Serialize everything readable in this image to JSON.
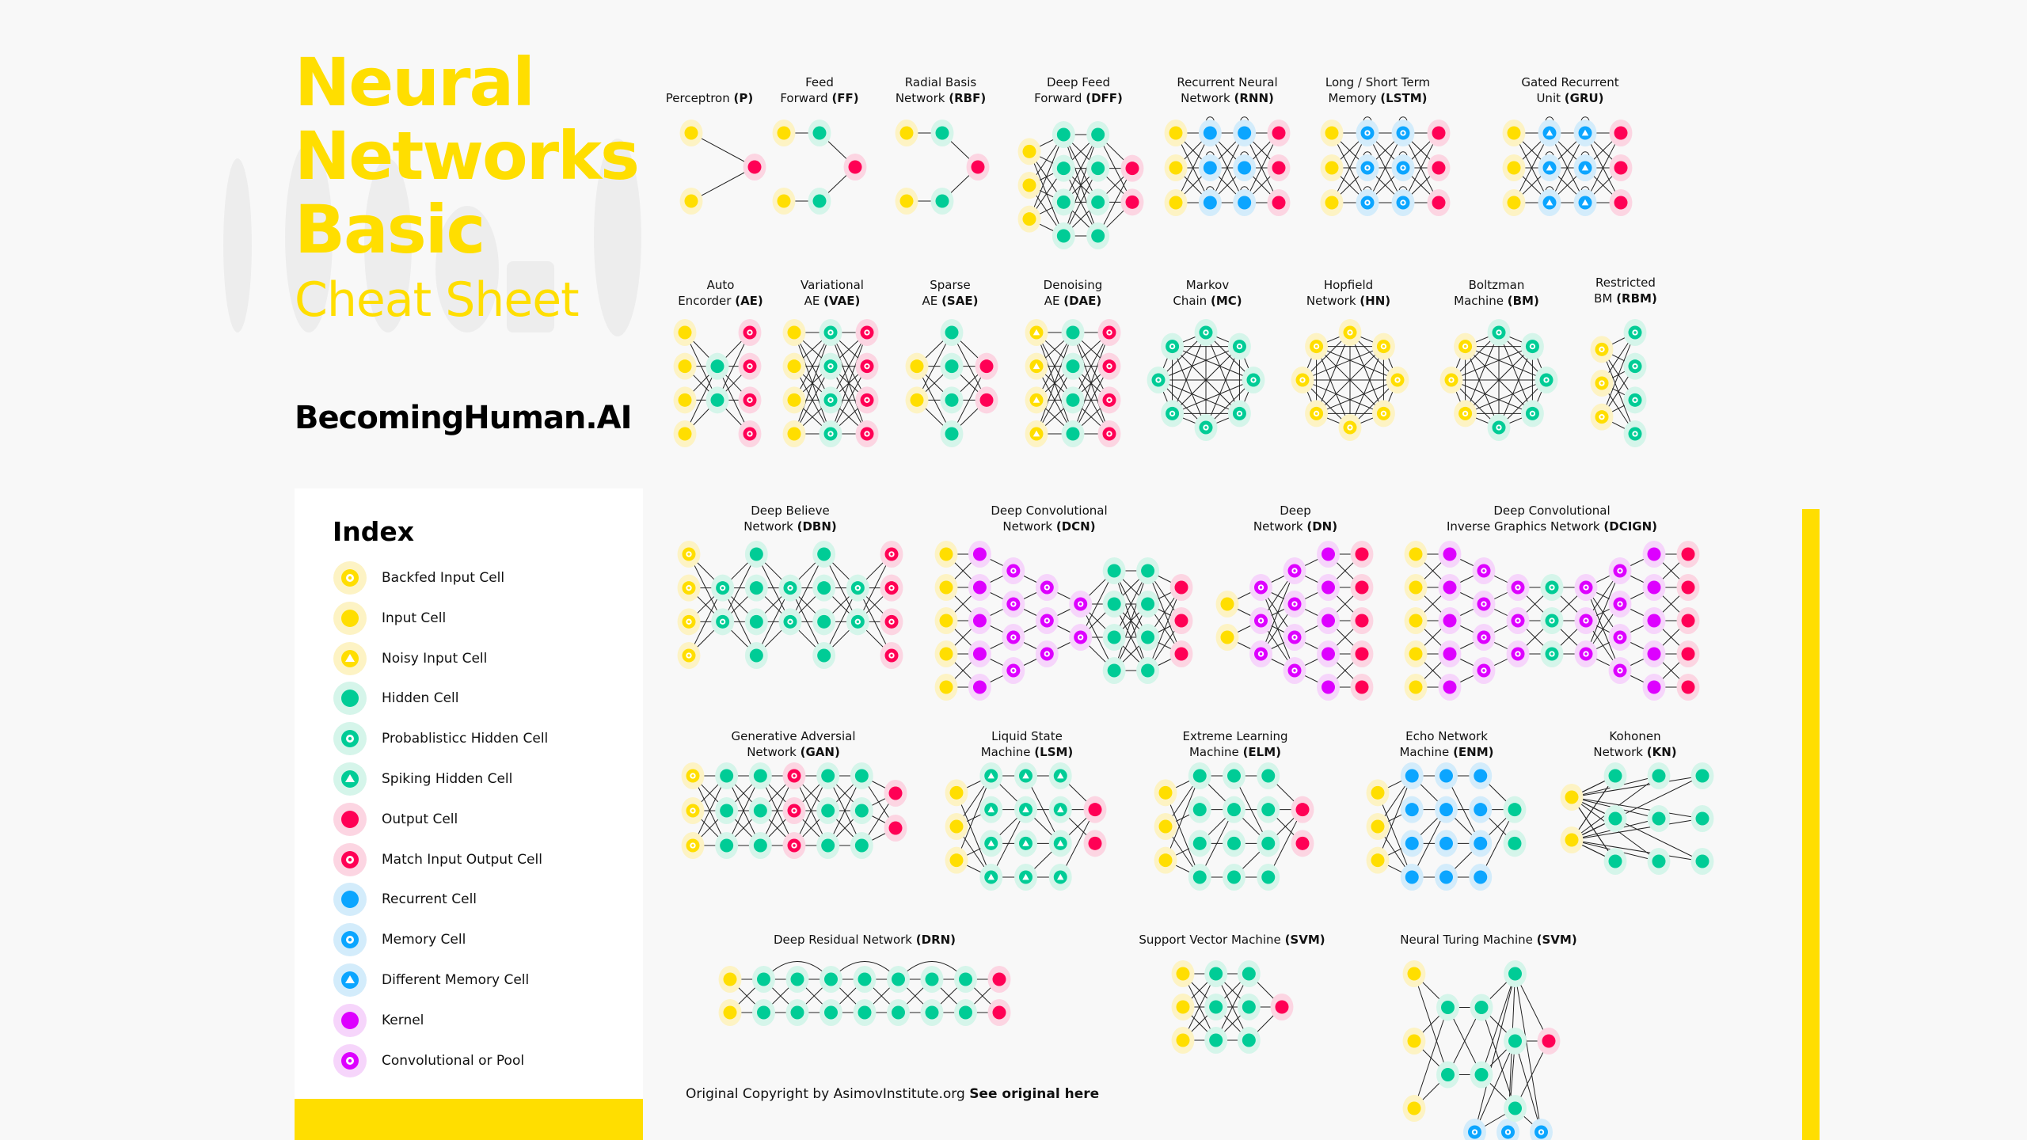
{
  "header": {
    "title_lines": [
      "Neural",
      "Networks",
      "Basic"
    ],
    "subtitle": "Cheat Sheet",
    "brand": "BecomingHuman.AI"
  },
  "colors": {
    "accent": "#ffde00",
    "input": "#ffde00",
    "input_halo": "#fdf3c4",
    "hidden": "#00cc96",
    "hidden_halo": "#d5f5ea",
    "output": "#ff0055",
    "output_halo": "#fcd5e2",
    "recurrent": "#0ba5ff",
    "recurrent_halo": "#d3ecfb",
    "kernel": "#dd00ff",
    "kernel_halo": "#f6d5fb",
    "edge": "#222222"
  },
  "index": {
    "title": "Index",
    "items": [
      {
        "label": "Backfed Input Cell",
        "type": "backfed-input",
        "icon": "yellow-ring-icon"
      },
      {
        "label": "Input Cell",
        "type": "input",
        "icon": "yellow-dot-icon"
      },
      {
        "label": "Noisy Input Cell",
        "type": "noisy-input",
        "icon": "yellow-triangle-icon"
      },
      {
        "label": "Hidden Cell",
        "type": "hidden",
        "icon": "green-dot-icon"
      },
      {
        "label": "Probablisticc Hidden Cell",
        "type": "prob-hidden",
        "icon": "green-ring-icon"
      },
      {
        "label": "Spiking Hidden Cell",
        "type": "spiking-hidden",
        "icon": "green-triangle-icon"
      },
      {
        "label": "Output Cell",
        "type": "output",
        "icon": "red-dot-icon"
      },
      {
        "label": "Match Input Output Cell",
        "type": "match-io",
        "icon": "red-ring-icon"
      },
      {
        "label": "Recurrent Cell",
        "type": "recurrent",
        "icon": "blue-dot-icon"
      },
      {
        "label": "Memory Cell",
        "type": "memory",
        "icon": "blue-ring-icon"
      },
      {
        "label": "Different Memory Cell",
        "type": "diff-memory",
        "icon": "blue-triangle-icon"
      },
      {
        "label": "Kernel",
        "type": "kernel",
        "icon": "purple-dot-icon"
      },
      {
        "label": "Convolutional or Pool",
        "type": "conv",
        "icon": "purple-ring-icon"
      }
    ]
  },
  "networks": [
    {
      "id": "p",
      "name": "Perceptron",
      "abbr": "P",
      "lines": [
        "Perceptron"
      ],
      "layers": [
        [
          "input",
          "input"
        ],
        [
          "output"
        ]
      ],
      "conn": "full"
    },
    {
      "id": "ff",
      "name": "Feed Forward",
      "abbr": "FF",
      "lines": [
        "Feed",
        "Forward"
      ],
      "layers": [
        [
          "input",
          "input"
        ],
        [
          "hidden",
          "hidden"
        ],
        [
          "output"
        ]
      ],
      "conn": "ff_straight"
    },
    {
      "id": "rbf",
      "name": "Radial Basis Network",
      "abbr": "RBF",
      "lines": [
        "Radial Basis",
        "Network"
      ],
      "layers": [
        [
          "input",
          "input"
        ],
        [
          "hidden",
          "hidden"
        ],
        [
          "output"
        ]
      ],
      "conn": "ff_straight"
    },
    {
      "id": "dff",
      "name": "Deep Feed Forward",
      "abbr": "DFF",
      "lines": [
        "Deep Feed",
        "Forward"
      ],
      "layers": [
        [
          "input",
          "input",
          "input"
        ],
        [
          "hidden",
          "hidden",
          "hidden",
          "hidden"
        ],
        [
          "hidden",
          "hidden",
          "hidden",
          "hidden"
        ],
        [
          "output",
          "output"
        ]
      ],
      "conn": "full"
    },
    {
      "id": "rnn",
      "name": "Recurrent Neural Network",
      "abbr": "RNN",
      "lines": [
        "Recurrent Neural",
        "Network"
      ],
      "layers": [
        [
          "input",
          "input",
          "input"
        ],
        [
          "recurrent",
          "recurrent",
          "recurrent"
        ],
        [
          "recurrent",
          "recurrent",
          "recurrent"
        ],
        [
          "output",
          "output",
          "output"
        ]
      ],
      "conn": "full",
      "loops": true
    },
    {
      "id": "lstm",
      "name": "Long / Short Term Memory",
      "abbr": "LSTM",
      "lines": [
        "Long / Short Term",
        "Memory"
      ],
      "layers": [
        [
          "input",
          "input",
          "input"
        ],
        [
          "memory",
          "memory",
          "memory"
        ],
        [
          "memory",
          "memory",
          "memory"
        ],
        [
          "output",
          "output",
          "output"
        ]
      ],
      "conn": "full",
      "loops": true
    },
    {
      "id": "gru",
      "name": "Gated Recurrent Unit",
      "abbr": "GRU",
      "lines": [
        "Gated Recurrent",
        "Unit"
      ],
      "layers": [
        [
          "input",
          "input",
          "input"
        ],
        [
          "diff-memory",
          "diff-memory",
          "diff-memory"
        ],
        [
          "diff-memory",
          "diff-memory",
          "diff-memory"
        ],
        [
          "output",
          "output",
          "output"
        ]
      ],
      "conn": "full",
      "loops": true
    },
    {
      "id": "ae",
      "name": "Auto Encorder",
      "abbr": "AE",
      "lines": [
        "Auto",
        "Encorder"
      ],
      "layers": [
        [
          "input",
          "input",
          "input",
          "input"
        ],
        [
          "hidden",
          "hidden"
        ],
        [
          "match-io",
          "match-io",
          "match-io",
          "match-io"
        ]
      ],
      "conn": "full"
    },
    {
      "id": "vae",
      "name": "Variational AE",
      "abbr": "VAE",
      "lines": [
        "Variational",
        "AE"
      ],
      "layers": [
        [
          "input",
          "input",
          "input",
          "input"
        ],
        [
          "prob-hidden",
          "prob-hidden",
          "prob-hidden",
          "prob-hidden"
        ],
        [
          "match-io",
          "match-io",
          "match-io",
          "match-io"
        ]
      ],
      "conn": "full"
    },
    {
      "id": "sae",
      "name": "Sparse AE",
      "abbr": "SAE",
      "lines": [
        "Sparse",
        "AE"
      ],
      "layers": [
        [
          "input",
          "input"
        ],
        [
          "hidden",
          "hidden",
          "hidden",
          "hidden"
        ],
        [
          "output",
          "output"
        ]
      ],
      "conn": "full"
    },
    {
      "id": "dae",
      "name": "Denoising AE",
      "abbr": "DAE",
      "lines": [
        "Denoising",
        "AE"
      ],
      "layers": [
        [
          "noisy-input",
          "noisy-input",
          "noisy-input",
          "noisy-input"
        ],
        [
          "hidden",
          "hidden",
          "hidden",
          "hidden"
        ],
        [
          "match-io",
          "match-io",
          "match-io",
          "match-io"
        ]
      ],
      "conn": "full"
    },
    {
      "id": "mc",
      "name": "Markov Chain",
      "abbr": "MC",
      "lines": [
        "Markov",
        "Chain"
      ],
      "ring": [
        "prob-hidden",
        "prob-hidden",
        "prob-hidden",
        "prob-hidden",
        "prob-hidden",
        "prob-hidden",
        "prob-hidden",
        "prob-hidden"
      ]
    },
    {
      "id": "hn",
      "name": "Hopfield Network",
      "abbr": "HN",
      "lines": [
        "Hopfield",
        "Network"
      ],
      "ring": [
        "backfed-input",
        "backfed-input",
        "backfed-input",
        "backfed-input",
        "backfed-input",
        "backfed-input",
        "backfed-input",
        "backfed-input"
      ]
    },
    {
      "id": "bm",
      "name": "Boltzman Machine",
      "abbr": "BM",
      "lines": [
        "Boltzman",
        "Machine"
      ],
      "ring": [
        "prob-hidden",
        "prob-hidden",
        "prob-hidden",
        "prob-hidden",
        "prob-hidden",
        "backfed-input",
        "backfed-input",
        "backfed-input"
      ]
    },
    {
      "id": "rbm",
      "name": "Restricted BM",
      "abbr": "RBM",
      "lines": [
        "Restricted",
        "BM"
      ],
      "layers": [
        [
          "backfed-input",
          "backfed-input",
          "backfed-input"
        ],
        [
          "prob-hidden",
          "prob-hidden",
          "prob-hidden",
          "prob-hidden"
        ]
      ],
      "conn": "full"
    },
    {
      "id": "dbn",
      "name": "Deep Believe Network",
      "abbr": "DBN",
      "lines": [
        "Deep Believe",
        "Network"
      ],
      "layers": [
        [
          "backfed-input",
          "backfed-input",
          "backfed-input",
          "backfed-input"
        ],
        [
          "prob-hidden",
          "prob-hidden"
        ],
        [
          "hidden",
          "hidden",
          "hidden",
          "hidden"
        ],
        [
          "prob-hidden",
          "prob-hidden"
        ],
        [
          "hidden",
          "hidden",
          "hidden",
          "hidden"
        ],
        [
          "prob-hidden",
          "prob-hidden"
        ],
        [
          "match-io",
          "match-io",
          "match-io",
          "match-io"
        ]
      ],
      "conn": "full"
    },
    {
      "id": "dcn",
      "name": "Deep Convolutional Network",
      "abbr": "DCN",
      "lines": [
        "Deep Convolutional",
        "Network"
      ],
      "layers": [
        [
          "input",
          "input",
          "input",
          "input",
          "input"
        ],
        [
          "kernel",
          "kernel",
          "kernel",
          "kernel",
          "kernel"
        ],
        [
          "conv",
          "conv",
          "conv",
          "conv"
        ],
        [
          "conv",
          "conv",
          "conv"
        ],
        [
          "conv",
          "conv"
        ],
        [
          "hidden",
          "hidden",
          "hidden",
          "hidden"
        ],
        [
          "hidden",
          "hidden",
          "hidden",
          "hidden"
        ],
        [
          "output",
          "output",
          "output"
        ]
      ],
      "conn": "local"
    },
    {
      "id": "dn",
      "name": "Deep Network",
      "abbr": "DN",
      "lines": [
        "Deep",
        "Network"
      ],
      "layers": [
        [
          "input",
          "input"
        ],
        [
          "conv",
          "conv",
          "conv"
        ],
        [
          "conv",
          "conv",
          "conv",
          "conv"
        ],
        [
          "kernel",
          "kernel",
          "kernel",
          "kernel",
          "kernel"
        ],
        [
          "output",
          "output",
          "output",
          "output",
          "output"
        ]
      ],
      "conn": "local"
    },
    {
      "id": "dcign",
      "name": "Deep Convolutional Inverse Graphics Network",
      "abbr": "DCIGN",
      "lines": [
        "Deep Convolutional",
        "Inverse Graphics Network"
      ],
      "layers": [
        [
          "input",
          "input",
          "input",
          "input",
          "input"
        ],
        [
          "kernel",
          "kernel",
          "kernel",
          "kernel",
          "kernel"
        ],
        [
          "conv",
          "conv",
          "conv",
          "conv"
        ],
        [
          "conv",
          "conv",
          "conv"
        ],
        [
          "prob-hidden",
          "prob-hidden",
          "prob-hidden"
        ],
        [
          "conv",
          "conv",
          "conv"
        ],
        [
          "conv",
          "conv",
          "conv",
          "conv"
        ],
        [
          "kernel",
          "kernel",
          "kernel",
          "kernel",
          "kernel"
        ],
        [
          "output",
          "output",
          "output",
          "output",
          "output"
        ]
      ],
      "conn": "local"
    },
    {
      "id": "gan",
      "name": "Generative Adversial Network",
      "abbr": "GAN",
      "lines": [
        "Generative Adversial",
        "Network"
      ],
      "layers": [
        [
          "backfed-input",
          "backfed-input",
          "backfed-input"
        ],
        [
          "hidden",
          "hidden",
          "hidden"
        ],
        [
          "hidden",
          "hidden",
          "hidden"
        ],
        [
          "match-io",
          "match-io",
          "match-io"
        ],
        [
          "hidden",
          "hidden",
          "hidden"
        ],
        [
          "hidden",
          "hidden",
          "hidden"
        ],
        [
          "output",
          "output"
        ]
      ],
      "conn": "full"
    },
    {
      "id": "lsm",
      "name": "Liquid State Machine",
      "abbr": "LSM",
      "lines": [
        "Liquid State",
        "Machine"
      ],
      "layers": [
        [
          "input",
          "input",
          "input"
        ],
        [
          "spiking-hidden",
          "spiking-hidden",
          "spiking-hidden",
          "spiking-hidden"
        ],
        [
          "spiking-hidden",
          "spiking-hidden",
          "spiking-hidden",
          "spiking-hidden"
        ],
        [
          "spiking-hidden",
          "spiking-hidden",
          "spiking-hidden",
          "spiking-hidden"
        ],
        [
          "output",
          "output"
        ]
      ],
      "conn": "sparse"
    },
    {
      "id": "elm",
      "name": "Extreme Learning Machine",
      "abbr": "ELM",
      "lines": [
        "Extreme Learning",
        "Machine"
      ],
      "layers": [
        [
          "input",
          "input",
          "input"
        ],
        [
          "hidden",
          "hidden",
          "hidden",
          "hidden"
        ],
        [
          "hidden",
          "hidden",
          "hidden",
          "hidden"
        ],
        [
          "hidden",
          "hidden",
          "hidden",
          "hidden"
        ],
        [
          "output",
          "output"
        ]
      ],
      "conn": "sparse"
    },
    {
      "id": "enm",
      "name": "Echo Network Machine",
      "abbr": "ENM",
      "lines": [
        "Echo Network",
        "Machine"
      ],
      "layers": [
        [
          "input",
          "input",
          "input"
        ],
        [
          "recurrent",
          "recurrent",
          "recurrent",
          "recurrent"
        ],
        [
          "recurrent",
          "recurrent",
          "recurrent",
          "recurrent"
        ],
        [
          "recurrent",
          "recurrent",
          "recurrent",
          "recurrent"
        ],
        [
          "hidden",
          "hidden"
        ]
      ],
      "conn": "sparse"
    },
    {
      "id": "kn",
      "name": "Kohonen Network",
      "abbr": "KN",
      "lines": [
        "Kohonen",
        "Network"
      ],
      "layers": [
        [
          "input",
          "input"
        ],
        [
          "hidden",
          "hidden",
          "hidden"
        ],
        [
          "hidden",
          "hidden",
          "hidden"
        ],
        [
          "hidden",
          "hidden",
          "hidden"
        ]
      ],
      "conn": "star"
    },
    {
      "id": "drn",
      "name": "Deep Residual Network",
      "abbr": "DRN",
      "lines": [
        "Deep Residual Network"
      ],
      "layers": [
        [
          "input",
          "input"
        ],
        [
          "hidden",
          "hidden"
        ],
        [
          "hidden",
          "hidden"
        ],
        [
          "hidden",
          "hidden"
        ],
        [
          "hidden",
          "hidden"
        ],
        [
          "hidden",
          "hidden"
        ],
        [
          "hidden",
          "hidden"
        ],
        [
          "hidden",
          "hidden"
        ],
        [
          "output",
          "output"
        ]
      ],
      "conn": "full",
      "skips": true
    },
    {
      "id": "svm",
      "name": "Support Vector Machine",
      "abbr": "SVM",
      "lines": [
        "Support Vector Machine"
      ],
      "layers": [
        [
          "input",
          "input",
          "input"
        ],
        [
          "hidden",
          "hidden",
          "hidden"
        ],
        [
          "hidden",
          "hidden",
          "hidden"
        ],
        [
          "output"
        ]
      ],
      "conn": "full"
    },
    {
      "id": "ntm",
      "name": "Neural Turing Machine",
      "abbr": "SVM",
      "lines": [
        "Neural Turing Machine"
      ],
      "layers": [
        [
          "input",
          "input",
          "input"
        ],
        [
          "hidden",
          "hidden"
        ],
        [
          "hidden",
          "hidden"
        ],
        [
          "hidden",
          "hidden",
          "hidden"
        ],
        [
          "output"
        ]
      ],
      "conn": "full",
      "memory_bank": [
        "memory",
        "memory",
        "memory"
      ]
    }
  ],
  "footer": {
    "copyright": "Original Copyright by AsimovInstitute.org",
    "link": "See original here"
  }
}
